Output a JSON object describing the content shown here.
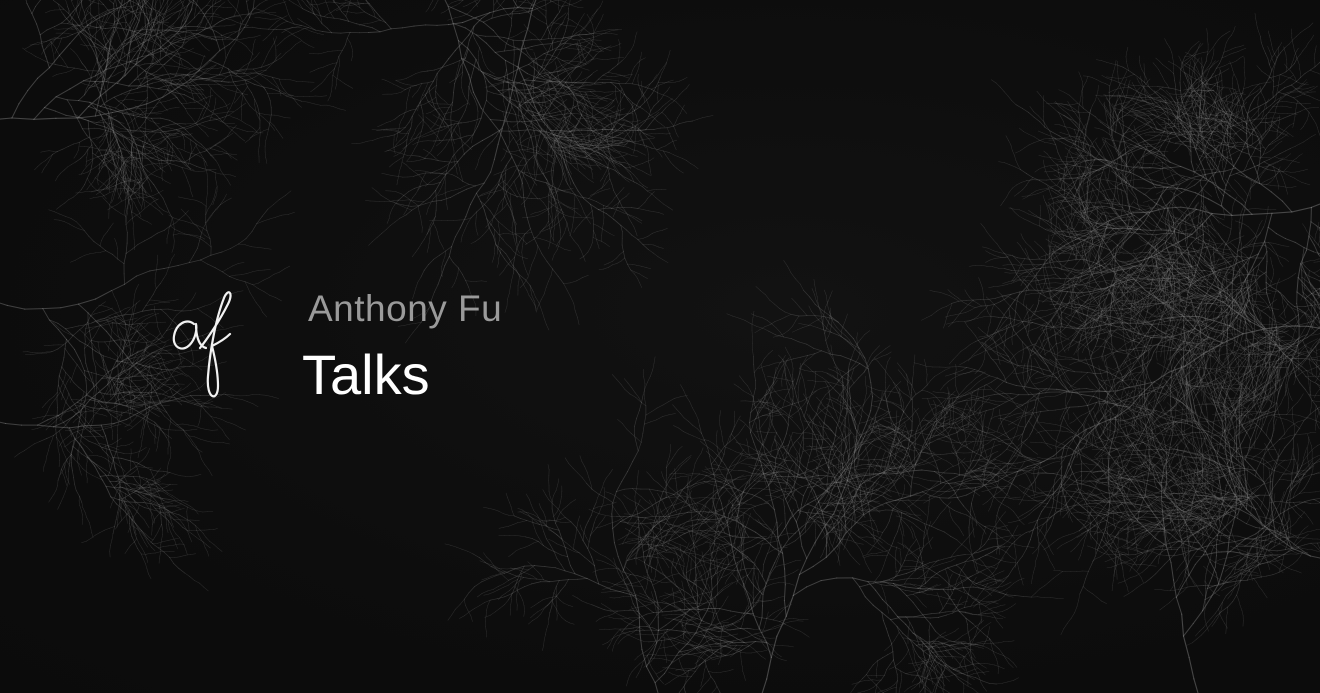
{
  "header": {
    "author": "Anthony Fu",
    "title": "Talks"
  },
  "logo": {
    "icon": "af-signature-icon",
    "text": "af"
  },
  "background": {
    "decoration": "plum-branches",
    "color": "#0e0e0e",
    "branch_color": "#8a8a8a"
  },
  "colors": {
    "author": "#9a9a9a",
    "title": "#ffffff"
  }
}
